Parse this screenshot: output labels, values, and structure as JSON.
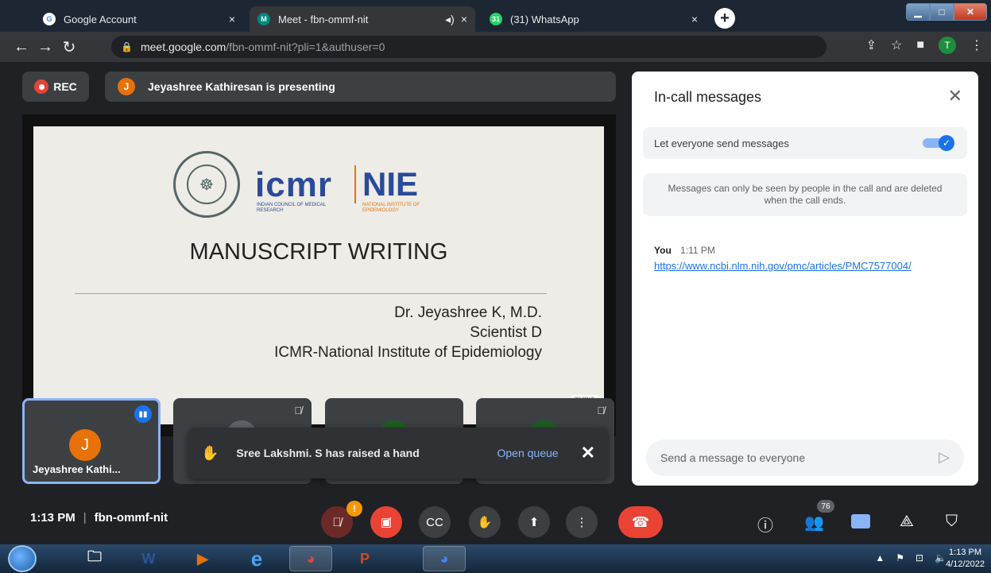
{
  "browser": {
    "tabs": [
      {
        "title": "Google Account",
        "favicon": "G",
        "close": "×"
      },
      {
        "title": "Meet - fbn-ommf-nit",
        "favicon": "M",
        "close": "×"
      },
      {
        "title": "(31) WhatsApp",
        "favicon": "31",
        "close": "×"
      }
    ],
    "new_tab": "+",
    "url_host": "meet.google.com",
    "url_path": "/fbn-ommf-nit?pli=1&authuser=0",
    "profile_initial": "T"
  },
  "meet": {
    "rec_label": "REC",
    "presenter_initial": "J",
    "presenting_text": "Jeyashree Kathiresan is presenting",
    "slide": {
      "logo_icmr": "icmr",
      "logo_icmr_sub": "INDIAN COUNCIL OF MEDICAL RESEARCH",
      "logo_nie": "NIE",
      "logo_nie_sub": "NATIONAL INSTITUTE OF EPIDEMIOLOGY",
      "title": "MANUSCRIPT WRITING",
      "author": "Dr. Jeyashree K, M.D.",
      "role": "Scientist D",
      "institute": "ICMR-National Institute of Epidemiology",
      "footer": "nie.gov.in"
    },
    "tiles": [
      {
        "initial": "J",
        "name": "Jeyashree Kathi..."
      }
    ],
    "toast": {
      "message": "Sree Lakshmi. S has raised a hand",
      "action": "Open queue"
    },
    "time": "1:13 PM",
    "meeting_code": "fbn-ommf-nit",
    "mic_warning": "!",
    "participant_count": "76"
  },
  "chat": {
    "title": "In-call messages",
    "toggle_label": "Let everyone send messages",
    "toggle_on": true,
    "info": "Messages can only be seen by people in the call and are deleted when the call ends.",
    "messages": [
      {
        "sender": "You",
        "time": "1:11 PM",
        "text": "https://www.ncbi.nlm.nih.gov/pmc/articles/PMC7577004/"
      }
    ],
    "placeholder": "Send a message to everyone"
  },
  "taskbar": {
    "time": "1:13 PM",
    "date": "4/12/2022"
  },
  "colors": {
    "accent": "#1a73e8",
    "danger": "#ea4335",
    "surface": "#3c4043",
    "background": "#202124"
  }
}
